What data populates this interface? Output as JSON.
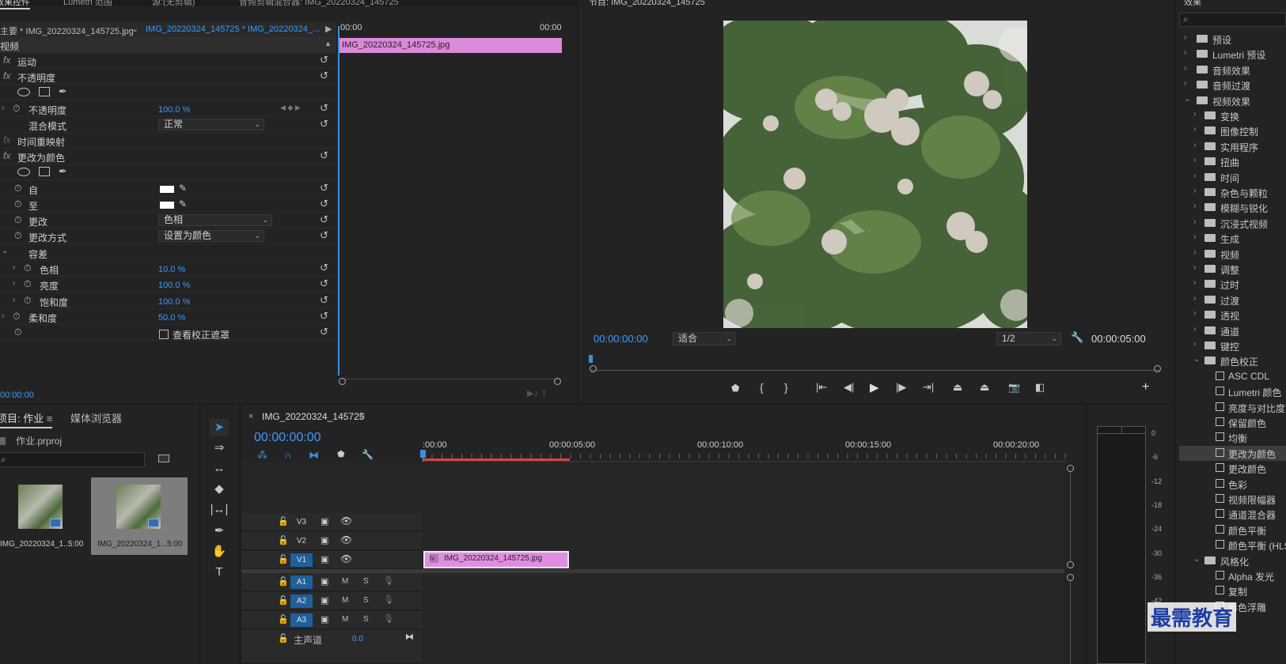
{
  "effect_controls": {
    "tabs": [
      "效果控件",
      "Lumetri 范围",
      "源:(无剪辑)",
      "音频剪辑混合器: IMG_20220324_145725"
    ],
    "master_label": "主要 * IMG_20220324_145725.jpg",
    "sequence_label": "IMG_20220324_145725 * IMG_20220324_...",
    "ruler_start": "00:00",
    "ruler_end": "00:00",
    "clip_name": "IMG_20220324_145725.jpg",
    "section": "视频",
    "motion": "运动",
    "opacity": "不透明度",
    "opacity_param": "不透明度",
    "opacity_value": "100.0 %",
    "blend_mode_label": "混合模式",
    "blend_mode_value": "正常",
    "time_remap": "时间重映射",
    "change_to_color": "更改为颜色",
    "from_label": "自",
    "to_label": "至",
    "change_label": "更改",
    "change_value": "色相",
    "change_by_label": "更改方式",
    "change_by_value": "设置为颜色",
    "tolerance_label": "容差",
    "hue_label": "色相",
    "hue_value": "10.0 %",
    "lightness_label": "亮度",
    "lightness_value": "100.0 %",
    "saturation_label": "饱和度",
    "saturation_value": "100.0 %",
    "softness_label": "柔和度",
    "softness_value": "50.0 %",
    "view_mask_label": "查看校正遮罩",
    "timecode": "00:00:00"
  },
  "program": {
    "title": "节目: IMG_20220324_145725",
    "timecode": "00:00:00:00",
    "fit": "适合",
    "resolution": "1/2",
    "duration": "00:00:05:00"
  },
  "effects": {
    "title": "效果",
    "items": [
      "预设",
      "Lumetri 预设",
      "音频效果",
      "音频过渡",
      "视频效果",
      "变换",
      "图像控制",
      "实用程序",
      "扭曲",
      "时间",
      "杂色与颗粒",
      "模糊与锐化",
      "沉浸式视频",
      "生成",
      "视频",
      "调整",
      "过时",
      "过渡",
      "透视",
      "通道",
      "键控",
      "颜色校正"
    ],
    "subitems": [
      "ASC CDL",
      "Lumetri 颜色",
      "亮度与对比度",
      "保留颜色",
      "均衡",
      "更改为颜色",
      "更改颜色",
      "色彩",
      "视频限幅器",
      "通道混合器",
      "颜色平衡",
      "颜色平衡 (HLS)"
    ],
    "stylize": "风格化",
    "stylize_items": [
      "Alpha 发光",
      "复制",
      "彩色浮雕"
    ]
  },
  "project": {
    "tab_project": "项目: 作业",
    "tab_media": "媒体浏览器",
    "file": "作业.prproj",
    "thumbs": [
      {
        "name": "IMG_20220324_1...",
        "dur": "5:00"
      },
      {
        "name": "IMG_20220324_1...",
        "dur": "5:00"
      }
    ]
  },
  "timeline": {
    "seq_name": "IMG_20220324_145725",
    "timecode": "00:00:00:00",
    "ruler": [
      ":00:00",
      "00:00:05:00",
      "00:00:10:00",
      "00:00:15:00",
      "00:00:20:00"
    ],
    "tracks_v": [
      "V3",
      "V2",
      "V1"
    ],
    "tracks_a": [
      "A1",
      "A2",
      "A3"
    ],
    "master": "主声道",
    "master_val": "0.0",
    "clip": "IMG_20220324_145725.jpg",
    "m": "M",
    "s": "S"
  },
  "meter": {
    "ticks": [
      "0",
      "-6",
      "-12",
      "-18",
      "-24",
      "-30",
      "-36",
      "-42"
    ]
  },
  "watermark": "最需教育"
}
